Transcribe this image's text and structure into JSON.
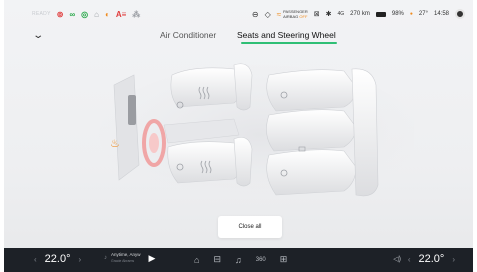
{
  "status_bar": {
    "ready_label": "READY",
    "warning_icons": [
      "tire-pressure-icon",
      "parking-lights-icon",
      "auto-lights-icon",
      "lane-assist-icon",
      "headlight-icon",
      "abs-icon",
      "seatbelt-icon"
    ],
    "airbag_line1": "PASSENGER",
    "airbag_line2": "AIRBAG",
    "airbag_state": "OFF",
    "signal": "4G",
    "range": "270 km",
    "battery": "98%",
    "outside_temp": "27°",
    "time": "14:58"
  },
  "nav": {
    "tabs": [
      {
        "label": "Air Conditioner",
        "active": false
      },
      {
        "label": "Seats and Steering Wheel",
        "active": true
      }
    ],
    "accent_color": "#2fbf75"
  },
  "main": {
    "seat_heating_icon_color": "#f08a1c",
    "close_all_label": "Close all"
  },
  "dock": {
    "left_temp": "22.0°",
    "right_temp": "22.0°",
    "song_title": "Anytime, Anyw",
    "song_artist": "Gracie Abrams",
    "dock_items": [
      "home-icon",
      "car-icon",
      "music-icon",
      "360-camera-icon",
      "apps-grid-icon"
    ],
    "view_360_label": "360"
  }
}
